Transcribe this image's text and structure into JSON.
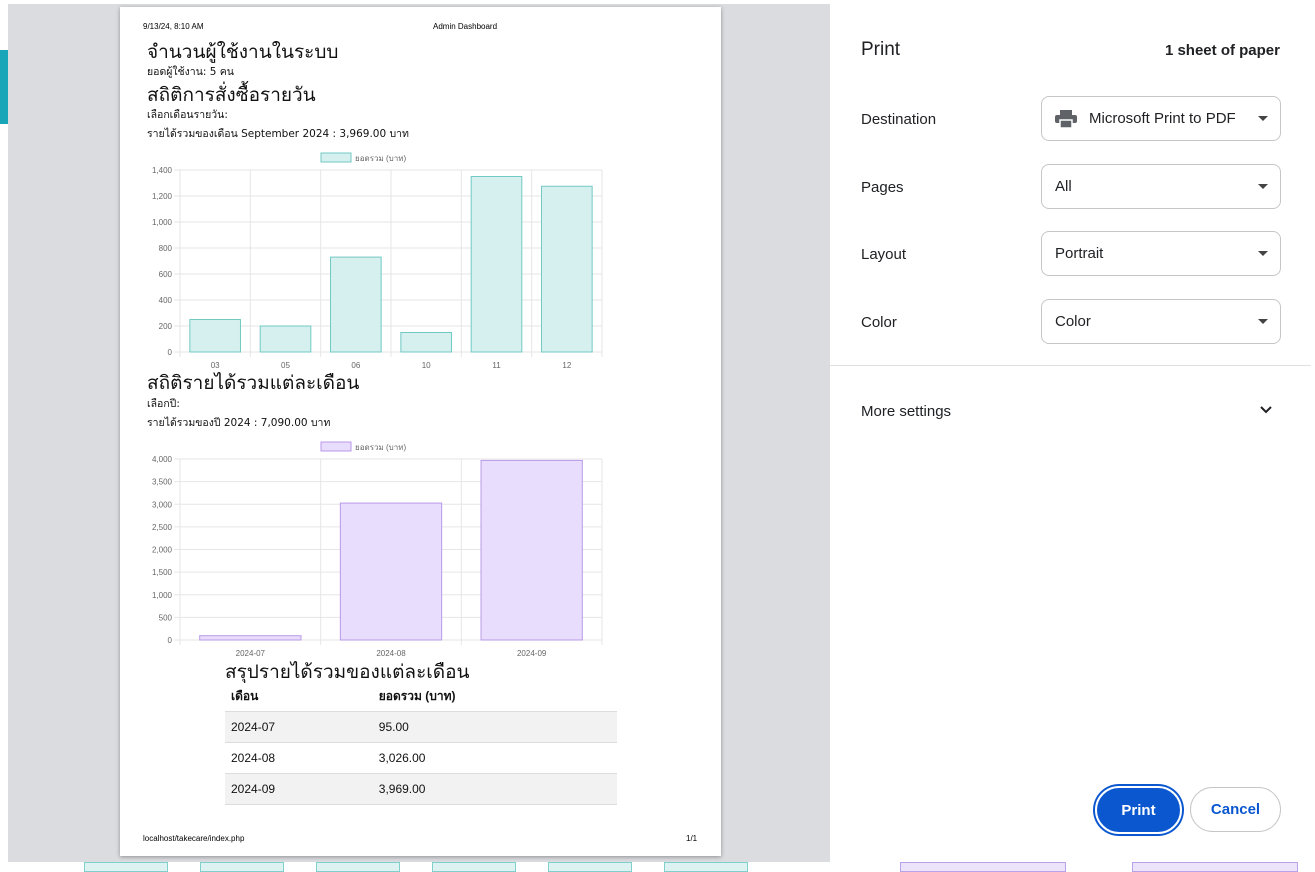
{
  "print_header": {
    "datetime": "9/13/24, 8:10 AM",
    "doc_title": "Admin Dashboard"
  },
  "print_footer": {
    "url": "localhost/takecare/index.php",
    "page_count": "1/1"
  },
  "users_section": {
    "title": "จำนวนผู้ใช้งานในระบบ",
    "count_text": "ยอดผู้ใช้งาน: 5 คน"
  },
  "daily_section": {
    "title": "สถิติการสั่งซื้อรายวัน",
    "select_label": "เลือกเดือนรายวัน:",
    "total_text": "รายได้รวมของเดือน September 2024 : 3,969.00 บาท"
  },
  "monthly_section": {
    "title": "สถิติรายได้รวมแต่ละเดือน",
    "select_label": "เลือกปี:",
    "total_text": "รายได้รวมของปี 2024 : 7,090.00 บาท"
  },
  "chart_data": [
    {
      "type": "bar",
      "categories": [
        "03",
        "05",
        "06",
        "10",
        "11",
        "12"
      ],
      "series": [
        {
          "name": "ยอดรวม (บาท)",
          "values": [
            250,
            200,
            730,
            150,
            1350,
            1275
          ]
        }
      ],
      "ylim": [
        0,
        1400
      ],
      "yticks": [
        0,
        200,
        400,
        600,
        800,
        "1,000",
        "1,200",
        "1,400"
      ],
      "grid": true,
      "legend": "top",
      "colors": {
        "fill": "#d5f0ee",
        "stroke": "#72c9c4"
      }
    },
    {
      "type": "bar",
      "categories": [
        "2024-07",
        "2024-08",
        "2024-09"
      ],
      "series": [
        {
          "name": "ยอดรวม (บาท)",
          "values": [
            95,
            3026,
            3969
          ]
        }
      ],
      "ylim": [
        0,
        4000
      ],
      "yticks": [
        0,
        500,
        "1,000",
        "1,500",
        "2,000",
        "2,500",
        "3,000",
        "3,500",
        "4,000"
      ],
      "grid": true,
      "legend": "top",
      "colors": {
        "fill": "#e9ddfd",
        "stroke": "#b89ae8"
      }
    }
  ],
  "summary": {
    "title": "สรุปรายได้รวมของแต่ละเดือน",
    "headers": [
      "เดือน",
      "ยอดรวม (บาท)"
    ],
    "rows": [
      [
        "2024-07",
        "95.00"
      ],
      [
        "2024-08",
        "3,026.00"
      ],
      [
        "2024-09",
        "3,969.00"
      ]
    ]
  },
  "print_settings": {
    "title": "Print",
    "sheets": "1 sheet of paper",
    "destination_label": "Destination",
    "destination_value": "Microsoft Print to PDF",
    "pages_label": "Pages",
    "pages_value": "All",
    "layout_label": "Layout",
    "layout_value": "Portrait",
    "color_label": "Color",
    "color_value": "Color",
    "more_settings": "More settings",
    "print_button": "Print",
    "cancel_button": "Cancel",
    "accent": "#0b57d0"
  }
}
